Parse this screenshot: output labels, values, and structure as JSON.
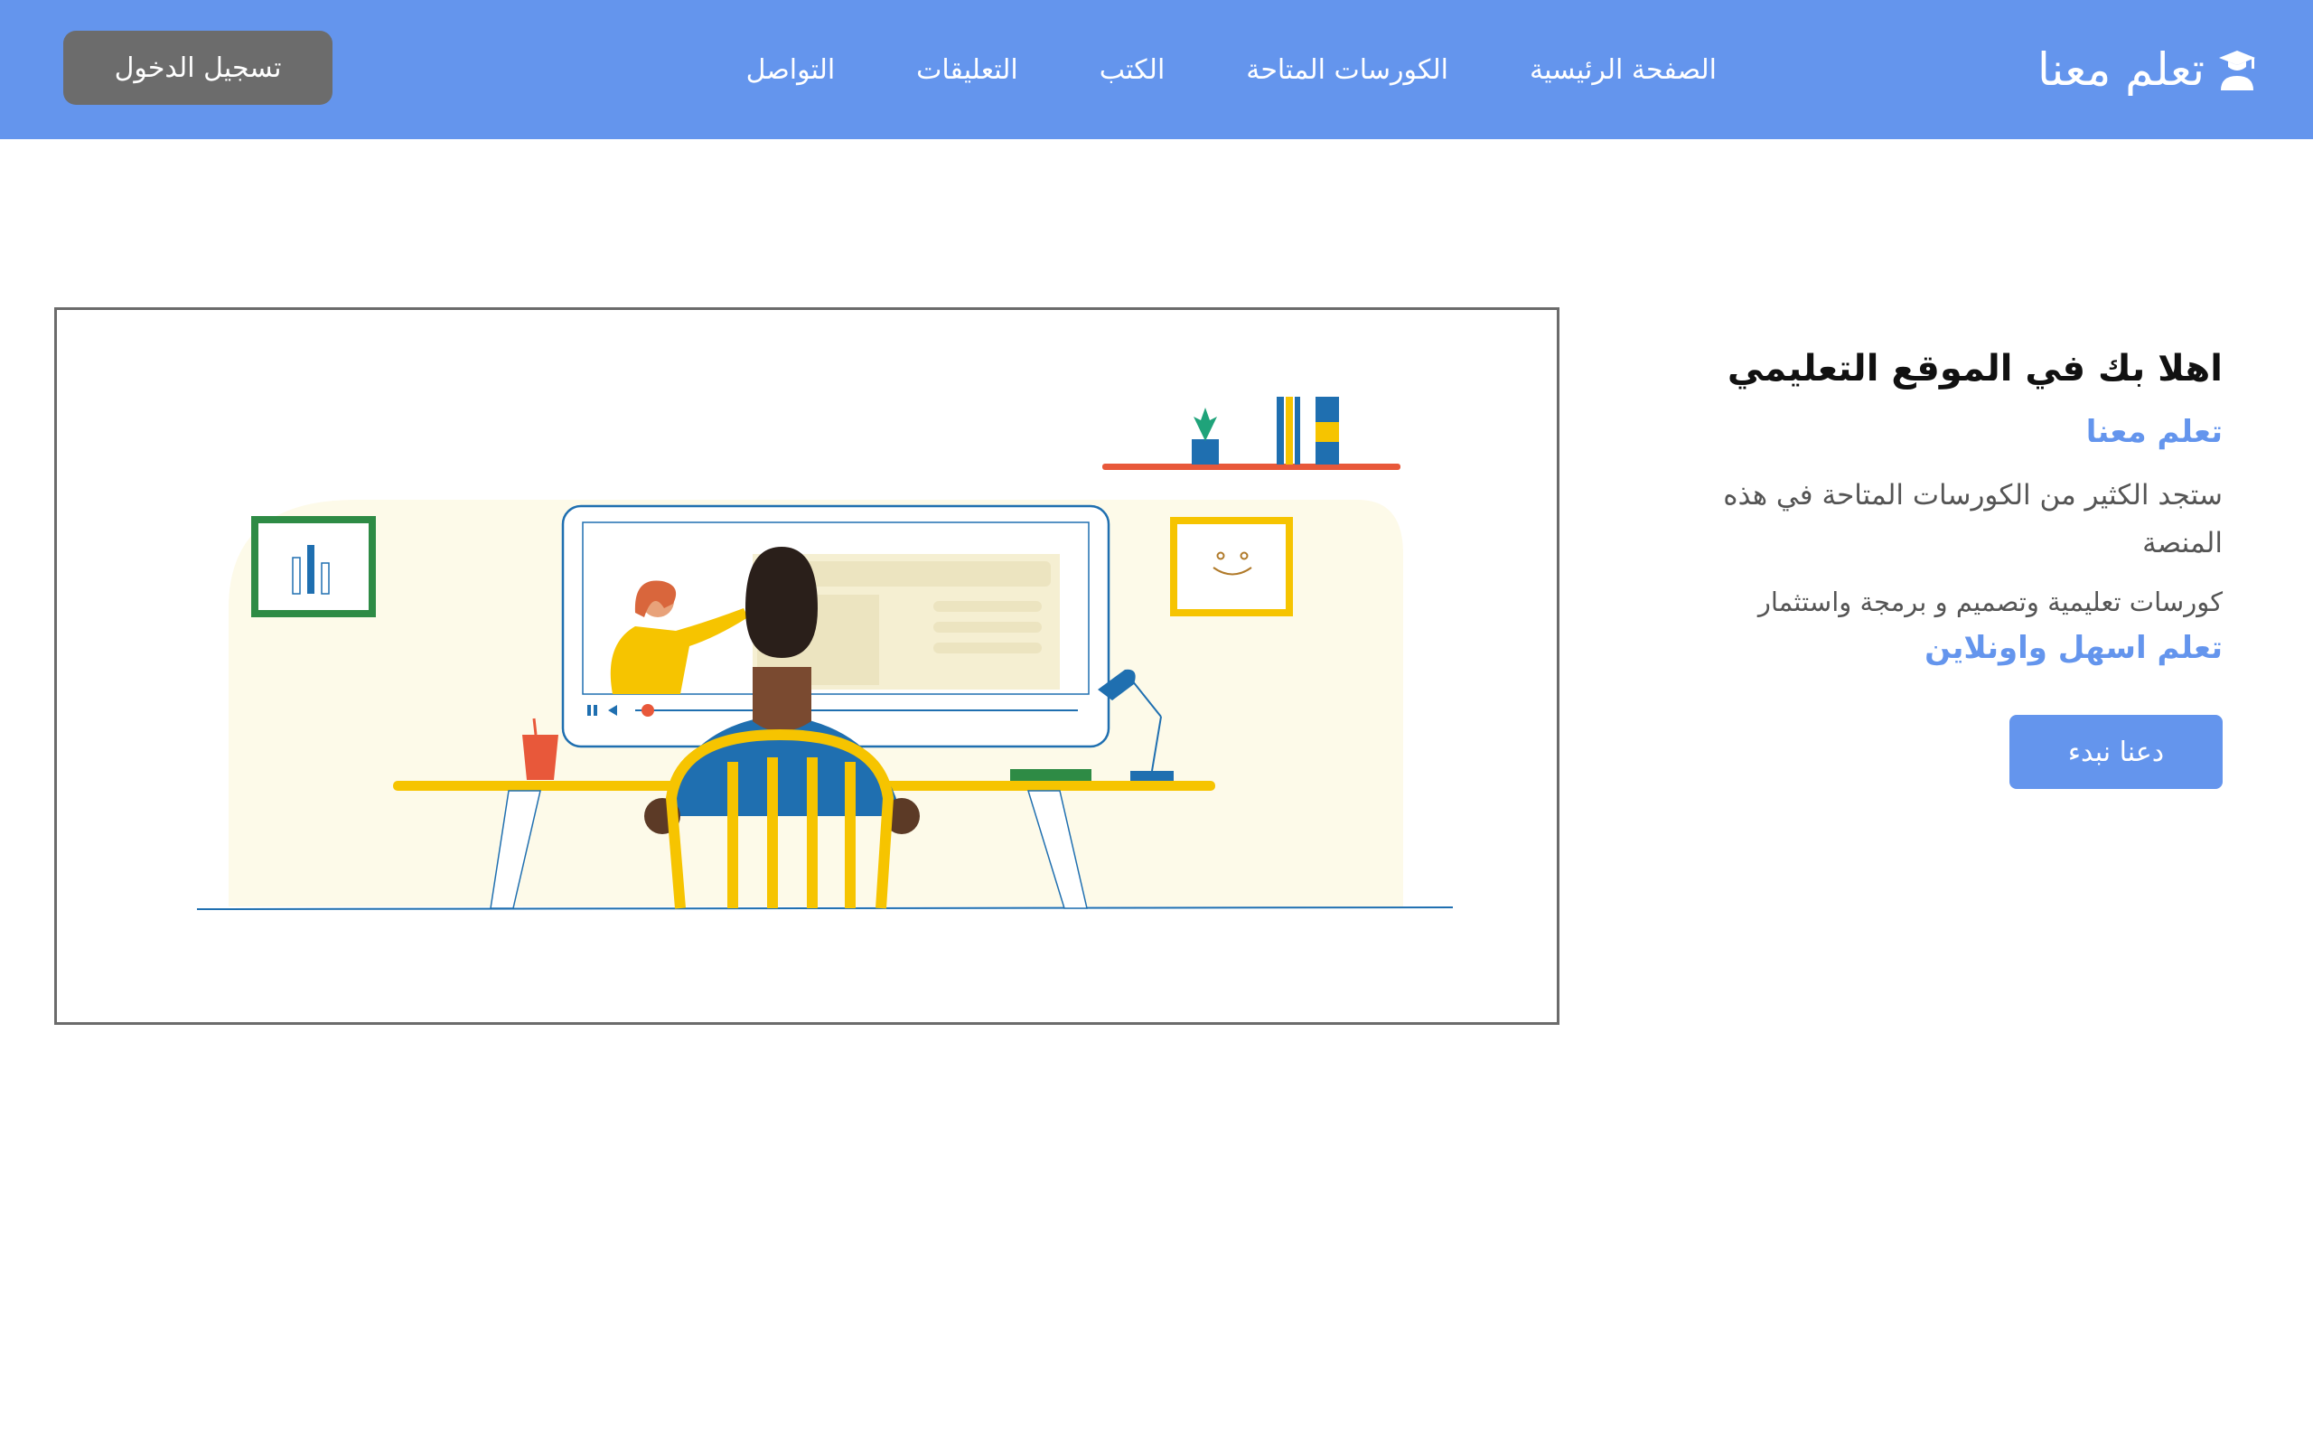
{
  "navbar": {
    "brand": "تعلم معنا",
    "brand_icon": "graduate-user-icon",
    "links": [
      "الصفحة الرئيسية",
      "الكورسات المتاحة",
      "الكتب",
      "التعليقات",
      "التواصل"
    ],
    "login_label": "تسجيل الدخول"
  },
  "hero": {
    "title": "اهلا بك في الموقع التعليمي",
    "subtitle": "تعلم معنا",
    "description": "ستجد الكثير من الكورسات المتاحة في هذه المنصة",
    "description2": "كورسات تعليمية وتصميم و برمجة واستثمار",
    "tagline": "تعلم اسهل واونلاين",
    "cta_label": "دعنا نبدء"
  },
  "colors": {
    "navbar_bg": "#6495ed",
    "login_btn_bg": "#6c6c6c",
    "accent": "#6495ed"
  }
}
